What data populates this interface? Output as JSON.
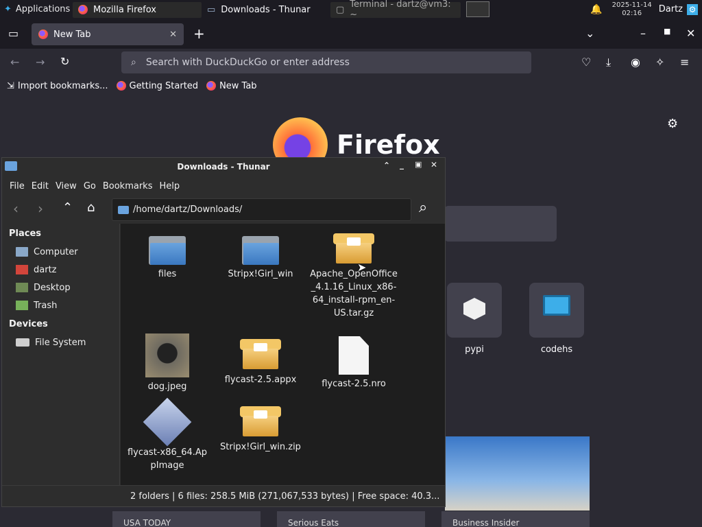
{
  "panel": {
    "applications": "Applications",
    "tasks": [
      "Mozilla Firefox",
      "Downloads - Thunar",
      "Terminal - dartz@vm3: ~"
    ],
    "date": "2025-11-14",
    "time": "02:16",
    "user": "Dartz"
  },
  "firefox": {
    "tab_label": "New Tab",
    "url_placeholder": "Search with DuckDuckGo or enter address",
    "bookmarks": [
      "Import bookmarks...",
      "Getting Started",
      "New Tab"
    ],
    "brand": "Firefox",
    "shortcuts": [
      {
        "label": "pypi"
      },
      {
        "label": "codehs"
      }
    ],
    "stories": [
      "USA TODAY",
      "Serious Eats",
      "Business Insider"
    ]
  },
  "thunar": {
    "title": "Downloads - Thunar",
    "menu": [
      "File",
      "Edit",
      "View",
      "Go",
      "Bookmarks",
      "Help"
    ],
    "location": "/home/dartz/Downloads/",
    "places_heading": "Places",
    "places": [
      "Computer",
      "dartz",
      "Desktop",
      "Trash"
    ],
    "devices_heading": "Devices",
    "devices": [
      "File System"
    ],
    "files": [
      {
        "name": "files",
        "kind": "folder"
      },
      {
        "name": "Stripx!Girl_win",
        "kind": "folder"
      },
      {
        "name": "Apache_OpenOffice_4.1.16_Linux_x86-64_install-rpm_en-US.tar.gz",
        "kind": "archive"
      },
      {
        "name": "dog.jpeg",
        "kind": "image"
      },
      {
        "name": "flycast-2.5.appx",
        "kind": "archive"
      },
      {
        "name": "flycast-2.5.nro",
        "kind": "document"
      },
      {
        "name": "flycast-x86_64.AppImage",
        "kind": "appimage"
      },
      {
        "name": "Stripx!Girl_win.zip",
        "kind": "archive"
      }
    ],
    "status": "2 folders  |  6 files: 258.5 MiB (271,067,533 bytes)  |  Free space: 40.3..."
  },
  "colors": {
    "accent": "#3daee9",
    "firefox_bg": "#2b2a33",
    "panel_bg": "#1c1b22"
  }
}
